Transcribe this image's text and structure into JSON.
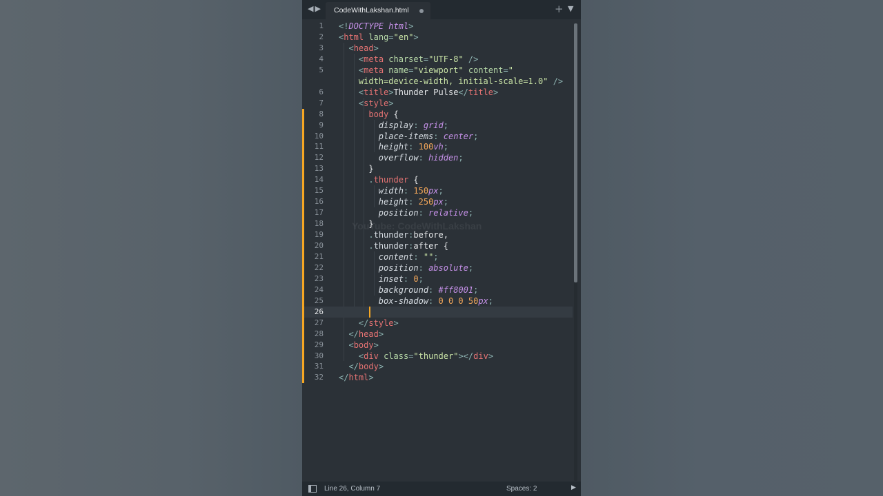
{
  "tab": {
    "filename": "CodeWithLakshan.html",
    "modified": true
  },
  "watermark": "YouTube: CodeWithLakshan",
  "status": {
    "position": "Line 26, Column 7",
    "indentation": "Spaces: 2"
  },
  "colors": {
    "accent_modified": "#f5a623",
    "editor_bg": "#2b3137",
    "tabbar_bg": "#232a30"
  },
  "icons": {
    "back": "triangle-left-icon",
    "forward": "triangle-right-icon",
    "new_tab": "plus-icon",
    "tab_menu": "chevron-down-icon",
    "panel": "sidebar-toggle-icon"
  },
  "code_lines": [
    {
      "n": "1",
      "html": "<span class='t-punct'>&lt;!</span><span class='t-doc'>DOCTYPE html</span><span class='t-punct'>&gt;</span>"
    },
    {
      "n": "2",
      "html": "<span class='t-punct'>&lt;</span><span class='t-tag'>html</span> <span class='t-attr'>lang</span><span class='t-punct'>=</span><span class='t-str'>\"en\"</span><span class='t-punct'>&gt;</span>"
    },
    {
      "n": "3",
      "html": "  <span class='t-punct'>&lt;</span><span class='t-tag'>head</span><span class='t-punct'>&gt;</span>"
    },
    {
      "n": "4",
      "html": "    <span class='t-punct'>&lt;</span><span class='t-tag'>meta</span> <span class='t-attr'>charset</span><span class='t-punct'>=</span><span class='t-str'>\"UTF-8\"</span> <span class='t-punct'>/&gt;</span>"
    },
    {
      "n": "5",
      "html": "    <span class='t-punct'>&lt;</span><span class='t-tag'>meta</span> <span class='t-attr'>name</span><span class='t-punct'>=</span><span class='t-str'>\"viewport\"</span> <span class='t-attr'>content</span><span class='t-punct'>=</span><span class='t-str'>\"</span>"
    },
    {
      "n": "",
      "html": "    <span class='t-str'>width=device-width, initial-scale=1.0\"</span> <span class='t-punct'>/&gt;</span>"
    },
    {
      "n": "6",
      "html": "    <span class='t-punct'>&lt;</span><span class='t-tag'>title</span><span class='t-punct'>&gt;</span><span class='t-text'>Thunder Pulse</span><span class='t-punct'>&lt;/</span><span class='t-tag'>title</span><span class='t-punct'>&gt;</span>"
    },
    {
      "n": "7",
      "html": "    <span class='t-punct'>&lt;</span><span class='t-tag'>style</span><span class='t-punct'>&gt;</span>"
    },
    {
      "n": "8",
      "html": "      <span class='t-sel'>body</span> <span class='t-text'>{</span>",
      "mark": true
    },
    {
      "n": "9",
      "html": "        <span class='t-prop'>display</span><span class='t-punct'>:</span> <span class='t-val'>grid</span><span class='t-punct'>;</span>",
      "mark": true
    },
    {
      "n": "10",
      "html": "        <span class='t-prop'>place-items</span><span class='t-punct'>:</span> <span class='t-val'>center</span><span class='t-punct'>;</span>",
      "mark": true
    },
    {
      "n": "11",
      "html": "        <span class='t-prop'>height</span><span class='t-punct'>:</span> <span class='t-num'>100</span><span class='t-unit'>vh</span><span class='t-punct'>;</span>",
      "mark": true
    },
    {
      "n": "12",
      "html": "        <span class='t-prop'>overflow</span><span class='t-punct'>:</span> <span class='t-val'>hidden</span><span class='t-punct'>;</span>",
      "mark": true
    },
    {
      "n": "13",
      "html": "      <span class='t-text'>}</span>",
      "mark": true
    },
    {
      "n": "14",
      "html": "      <span class='t-punct'>.</span><span class='t-sel'>thunder</span> <span class='t-text'>{</span>",
      "mark": true
    },
    {
      "n": "15",
      "html": "        <span class='t-prop'>width</span><span class='t-punct'>:</span> <span class='t-num'>150</span><span class='t-unit'>px</span><span class='t-punct'>;</span>",
      "mark": true
    },
    {
      "n": "16",
      "html": "        <span class='t-prop'>height</span><span class='t-punct'>:</span> <span class='t-num'>250</span><span class='t-unit'>px</span><span class='t-punct'>;</span>",
      "mark": true
    },
    {
      "n": "17",
      "html": "        <span class='t-prop'>position</span><span class='t-punct'>:</span> <span class='t-val'>relative</span><span class='t-punct'>;</span>",
      "mark": true
    },
    {
      "n": "18",
      "html": "      <span class='t-text'>}</span>",
      "mark": true
    },
    {
      "n": "19",
      "html": "      <span class='t-punct'>.</span><span class='t-cls'>thunder</span><span class='t-punct'>:</span><span class='t-text'>before,</span>",
      "mark": true
    },
    {
      "n": "20",
      "html": "      <span class='t-punct'>.</span><span class='t-cls'>thunder</span><span class='t-punct'>:</span><span class='t-text'>after {</span>",
      "mark": true
    },
    {
      "n": "21",
      "html": "        <span class='t-prop'>content</span><span class='t-punct'>:</span> <span class='t-str'>\"\"</span><span class='t-punct'>;</span>",
      "mark": true
    },
    {
      "n": "22",
      "html": "        <span class='t-prop'>position</span><span class='t-punct'>:</span> <span class='t-val'>absolute</span><span class='t-punct'>;</span>",
      "mark": true
    },
    {
      "n": "23",
      "html": "        <span class='t-prop'>inset</span><span class='t-punct'>:</span> <span class='t-num'>0</span><span class='t-punct'>;</span>",
      "mark": true
    },
    {
      "n": "24",
      "html": "        <span class='t-prop'>background</span><span class='t-punct'>:</span> <span class='t-val'>#ff8001</span><span class='t-punct'>;</span>",
      "mark": true
    },
    {
      "n": "25",
      "html": "        <span class='t-prop'>box-shadow</span><span class='t-punct'>:</span> <span class='t-num'>0 0 0 50</span><span class='t-unit'>px</span><span class='t-punct'>;</span>",
      "mark": true
    },
    {
      "n": "26",
      "html": "",
      "mark": true,
      "current": true
    },
    {
      "n": "27",
      "html": "    <span class='t-punct'>&lt;/</span><span class='t-tag'>style</span><span class='t-punct'>&gt;</span>",
      "mark": true
    },
    {
      "n": "28",
      "html": "  <span class='t-punct'>&lt;/</span><span class='t-tag'>head</span><span class='t-punct'>&gt;</span>",
      "mark": true
    },
    {
      "n": "29",
      "html": "  <span class='t-punct'>&lt;</span><span class='t-tag'>body</span><span class='t-punct'>&gt;</span>",
      "mark": true
    },
    {
      "n": "30",
      "html": "    <span class='t-punct'>&lt;</span><span class='t-tag'>div</span> <span class='t-attr'>class</span><span class='t-punct'>=</span><span class='t-str'>\"thunder\"</span><span class='t-punct'>&gt;&lt;/</span><span class='t-tag'>div</span><span class='t-punct'>&gt;</span>",
      "mark": true
    },
    {
      "n": "31",
      "html": "  <span class='t-punct'>&lt;/</span><span class='t-tag'>body</span><span class='t-punct'>&gt;</span>",
      "mark": true
    },
    {
      "n": "32",
      "html": "<span class='t-punct'>&lt;/</span><span class='t-tag'>html</span><span class='t-punct'>&gt;</span>",
      "mark": true
    }
  ]
}
